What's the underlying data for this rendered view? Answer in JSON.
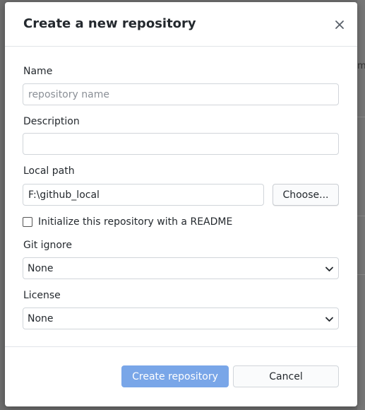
{
  "dialog": {
    "title": "Create a new repository",
    "close_icon": "close-icon"
  },
  "form": {
    "name": {
      "label": "Name",
      "value": "",
      "placeholder": "repository name"
    },
    "description": {
      "label": "Description",
      "value": "",
      "placeholder": ""
    },
    "local_path": {
      "label": "Local path",
      "value": "F:\\github_local",
      "choose_label": "Choose..."
    },
    "readme": {
      "label": "Initialize this repository with a README",
      "checked": false
    },
    "gitignore": {
      "label": "Git ignore",
      "selected": "None"
    },
    "license": {
      "label": "License",
      "selected": "None"
    }
  },
  "footer": {
    "create_label": "Create repository",
    "cancel_label": "Cancel"
  },
  "background": {
    "partial_text": "m"
  },
  "colors": {
    "primary_button": "#79a6e8",
    "title_text": "#24292e"
  }
}
